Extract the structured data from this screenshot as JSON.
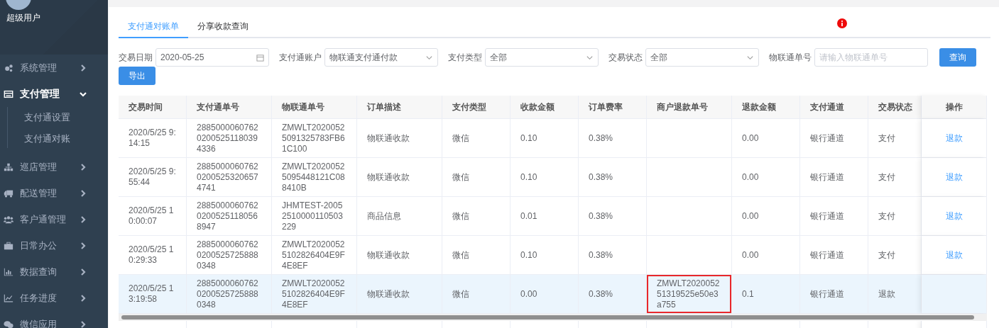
{
  "sidebar": {
    "user_name": "超级用户",
    "items": [
      {
        "label": "系统管理",
        "expanded": false
      },
      {
        "label": "支付管理",
        "expanded": true,
        "children": [
          {
            "label": "支付通设置"
          },
          {
            "label": "支付通对账"
          }
        ]
      },
      {
        "label": "巡店管理",
        "expanded": false
      },
      {
        "label": "配送管理",
        "expanded": false
      },
      {
        "label": "客户通管理",
        "expanded": false
      },
      {
        "label": "日常办公",
        "expanded": false
      },
      {
        "label": "数据查询",
        "expanded": false
      },
      {
        "label": "任务进度",
        "expanded": false
      },
      {
        "label": "微信应用",
        "expanded": false
      }
    ]
  },
  "tabs": [
    {
      "label": "支付通对账单",
      "selected": true
    },
    {
      "label": "分享收款查询",
      "selected": false
    }
  ],
  "filters": [
    {
      "kind": "date",
      "label": "交易日期",
      "value": "2020-05-25"
    },
    {
      "kind": "select",
      "label": "支付通账户",
      "value": "物联通支付通付款"
    },
    {
      "kind": "select",
      "label": "支付类型",
      "value": "全部"
    },
    {
      "kind": "select",
      "label": "交易状态",
      "value": "全部"
    },
    {
      "kind": "input",
      "label": "物联通单号",
      "placeholder": "请输入物联通单号"
    }
  ],
  "buttons": [
    "查询",
    "导出"
  ],
  "table": {
    "columns": [
      "交易时间",
      "支付通单号",
      "物联通单号",
      "订单描述",
      "支付类型",
      "收款金额",
      "订单费率",
      "商户退款单号",
      "退款金额",
      "支付通道",
      "交易状态",
      "操作"
    ],
    "rows": [
      {
        "selected": false,
        "marked": false,
        "cells": [
          "2020/5/25 9:14:15",
          "288500006076202005251180394336",
          "ZMWLT20200525091325783FB61C100",
          "物联通收款",
          "微信",
          "0.10",
          "0.38%",
          "",
          "0.00",
          "银行通道",
          "支付"
        ],
        "action": "退款"
      },
      {
        "selected": false,
        "marked": false,
        "cells": [
          "2020/5/25 9:55:44",
          "288500006076202005253206574741",
          "ZMWLT20200525095448121C088410B",
          "物联通收款",
          "微信",
          "0.10",
          "0.38%",
          "",
          "0.00",
          "银行通道",
          "支付"
        ],
        "action": "退款"
      },
      {
        "selected": false,
        "marked": false,
        "cells": [
          "2020/5/25 10:00:07",
          "288500006076202005251180568947",
          "JHMTEST-20052510000110503229",
          "商品信息",
          "微信",
          "0.01",
          "0.38%",
          "",
          "0.00",
          "银行通道",
          "支付"
        ],
        "action": "退款"
      },
      {
        "selected": false,
        "marked": false,
        "cells": [
          "2020/5/25 10:29:33",
          "288500006076202005257258880348",
          "ZMWLT20200525102826404E9F4E8EF",
          "物联通收款",
          "微信",
          "0.10",
          "0.38%",
          "",
          "0.00",
          "银行通道",
          "支付"
        ],
        "action": "退款"
      },
      {
        "selected": true,
        "marked": true,
        "cells": [
          "2020/5/25 13:19:58",
          "288500006076202005257258880348",
          "ZMWLT20200525102826404E9F4E8EF",
          "物联通收款",
          "微信",
          "0.00",
          "0.38%",
          "ZMWLT202005251319525e50e3a755",
          "0.1",
          "银行通道",
          "退款"
        ]
      }
    ]
  }
}
